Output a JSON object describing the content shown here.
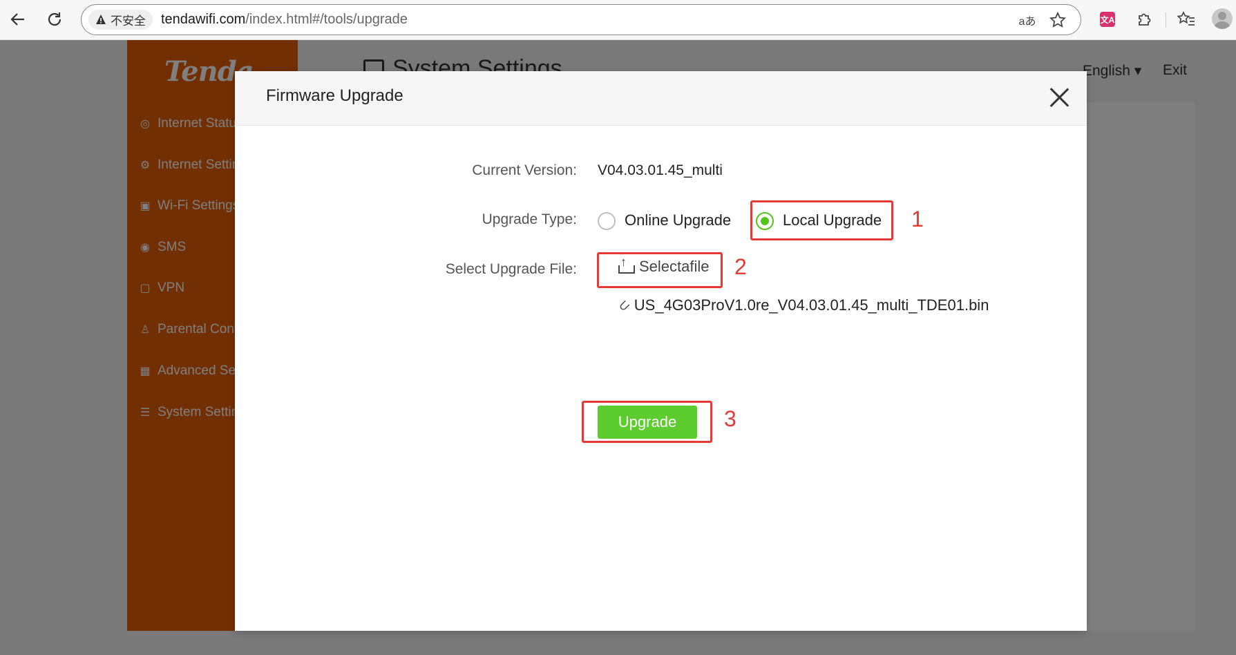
{
  "browser": {
    "security_label": "不安全",
    "url_host": "tendawifi.com",
    "url_path": "/index.html#/tools/upgrade",
    "read_aloud_glyph": "aあ",
    "translate_badge": "文A"
  },
  "page": {
    "logo": "Tenda",
    "title": "System Settings",
    "language": "English",
    "exit": "Exit",
    "sidebar": [
      {
        "label": "Internet Status",
        "icon": "globe-icon"
      },
      {
        "label": "Internet Settings",
        "icon": "settings-icon"
      },
      {
        "label": "Wi-Fi Settings",
        "icon": "wifi-icon"
      },
      {
        "label": "SMS",
        "icon": "sms-icon"
      },
      {
        "label": "VPN",
        "icon": "vpn-icon"
      },
      {
        "label": "Parental Control",
        "icon": "parental-icon"
      },
      {
        "label": "Advanced Settings",
        "icon": "grid-icon"
      },
      {
        "label": "System Settings",
        "icon": "system-icon"
      }
    ]
  },
  "modal": {
    "title": "Firmware Upgrade",
    "current_version_label": "Current Version:",
    "current_version_value": "V04.03.01.45_multi",
    "upgrade_type_label": "Upgrade Type:",
    "online_upgrade": "Online Upgrade",
    "local_upgrade": "Local Upgrade",
    "selected_upgrade_type": "Local Upgrade",
    "select_file_label": "Select Upgrade File:",
    "select_file_button": "Selectafile",
    "file_name": "US_4G03ProV1.0re_V04.03.01.45_multi_TDE01.bin",
    "upgrade_button": "Upgrade"
  },
  "annotations": {
    "color": "#e53935",
    "numbers": [
      "1",
      "2",
      "3"
    ]
  },
  "colors": {
    "sidebar": "#e45f06",
    "accent_green": "#5ccc2e",
    "radio_green": "#52c41a"
  }
}
